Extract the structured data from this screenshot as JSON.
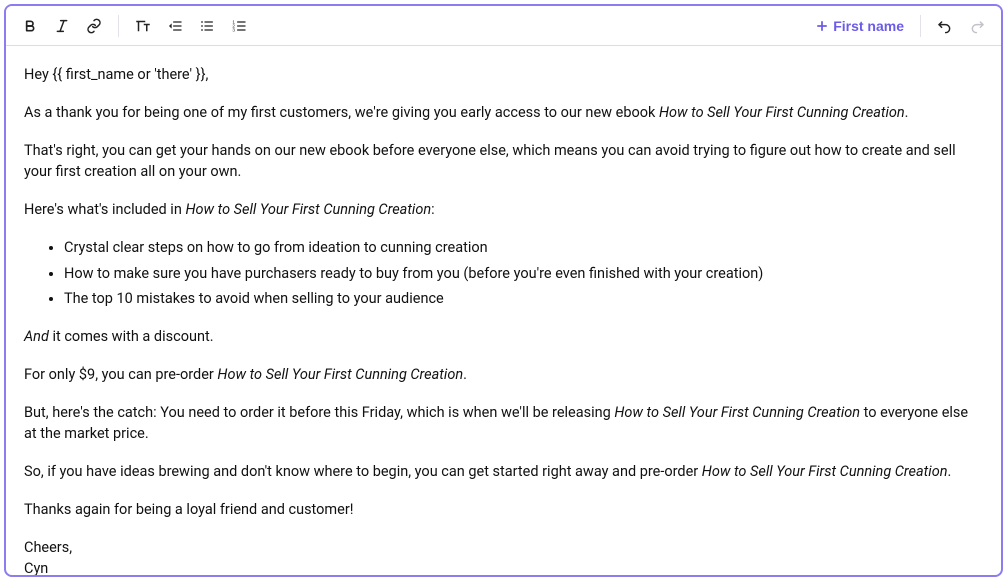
{
  "toolbar": {
    "insert_button_label": "First name"
  },
  "body": {
    "greeting": "Hey {{ first_name or 'there' }},",
    "p1_a": "As a thank you for being one of my first customers, we're giving you early access to our new ebook ",
    "book_title": "How to Sell Your First Cunning Creation",
    "p1_b": ".",
    "p2": "That's right, you can get your hands on our new ebook before everyone else, which means you can avoid trying to figure out how to create and sell your first creation all on your own.",
    "p3_a": "Here's what's included in ",
    "p3_b": ":",
    "bullets": [
      "Crystal clear steps on how to go from ideation to cunning creation",
      "How to make sure you have purchasers ready to buy from you (before you're even finished with your creation)",
      "The top 10 mistakes to avoid when selling to your audience"
    ],
    "p4_a": "And",
    "p4_b": " it comes with a discount.",
    "p5_a": "For only $9, you can pre-order ",
    "p5_b": ".",
    "p6_a": "But, here's the catch: You need to order it before this Friday, which is when we'll be releasing ",
    "p6_b": " to everyone else at the market price.",
    "p7_a": "So, if you have ideas brewing and don't know where to begin, you can get started right away and pre-order ",
    "p7_b": ".",
    "p8": "Thanks again for being a loyal friend and customer!",
    "signoff_a": "Cheers,",
    "signoff_b": "Cyn"
  }
}
